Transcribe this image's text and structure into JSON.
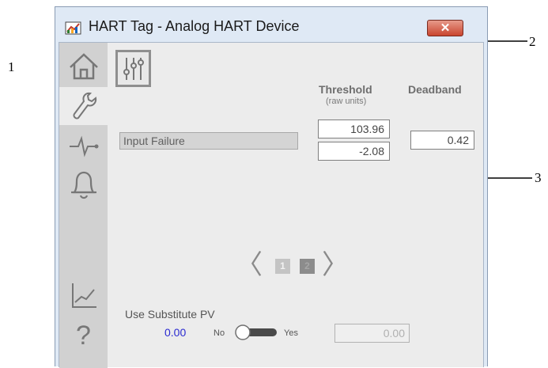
{
  "callouts": {
    "c1": "1",
    "c2": "2",
    "c3": "3"
  },
  "window": {
    "title": "HART Tag - Analog HART Device",
    "close_glyph": "✕"
  },
  "nav": {
    "items": [
      {
        "name": "home",
        "icon": "home-icon"
      },
      {
        "name": "maintenance",
        "icon": "wrench-icon",
        "active": true
      },
      {
        "name": "diagnostics",
        "icon": "pulse-icon"
      },
      {
        "name": "alarms",
        "icon": "bell-icon"
      },
      {
        "name": "trends",
        "icon": "trend-icon"
      },
      {
        "name": "help",
        "icon": "help-icon",
        "glyph": "?"
      }
    ]
  },
  "settings_tab": {
    "icon": "sliders-icon"
  },
  "table": {
    "threshold_header": "Threshold",
    "threshold_sub": "(raw units)",
    "deadband_header": "Deadband",
    "row_label": "Input Failure",
    "threshold_high": "103.96",
    "threshold_low": "-2.08",
    "deadband": "0.42"
  },
  "pagination": {
    "prev": "〈",
    "next": "〉",
    "page1": "1",
    "page2": "2",
    "current_page": 2
  },
  "substitute": {
    "label": "Use Substitute PV",
    "pv_value": "0.00",
    "no_label": "No",
    "yes_label": "Yes",
    "substitute_value": "0.00"
  },
  "colors": {
    "accent_value": "#2a2ad0",
    "close_button": "#c9452f",
    "nav_bg": "#d1d1d1"
  }
}
